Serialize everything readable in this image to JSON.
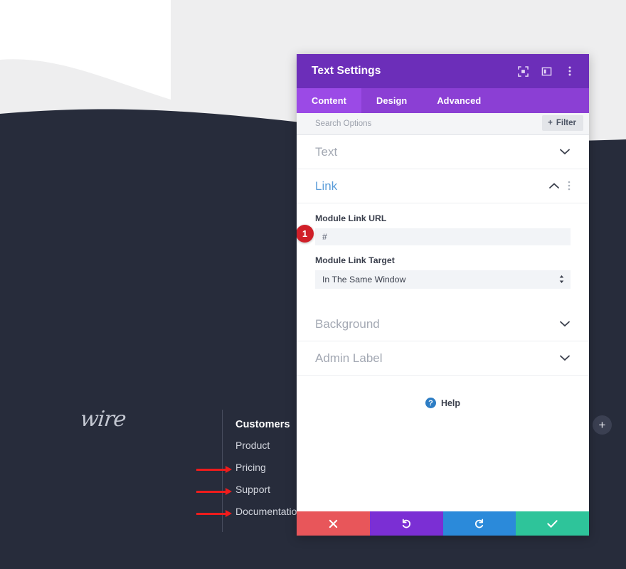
{
  "modal": {
    "title": "Text Settings",
    "header_icons": [
      {
        "name": "fullscreen-icon",
        "glyph": "⬚"
      },
      {
        "name": "layout-panel-icon",
        "glyph": "▧"
      },
      {
        "name": "kebab-menu-icon",
        "glyph": "⋮"
      }
    ],
    "tabs": [
      {
        "label": "Content",
        "active": true
      },
      {
        "label": "Design",
        "active": false
      },
      {
        "label": "Advanced",
        "active": false
      }
    ],
    "search": {
      "placeholder": "Search Options",
      "filter_label": "Filter",
      "filter_plus": "+"
    },
    "sections": [
      {
        "label": "Text",
        "open": false,
        "chevron": "∨"
      },
      {
        "label": "Link",
        "open": true,
        "chevron": "∧",
        "kebab": "⋮"
      },
      {
        "label": "Background",
        "open": false,
        "chevron": "∨"
      },
      {
        "label": "Admin Label",
        "open": false,
        "chevron": "∨"
      }
    ],
    "link_fields": {
      "url_label": "Module Link URL",
      "url_value": "#",
      "url_badge": "1",
      "target_label": "Module Link Target",
      "target_value": "In The Same Window",
      "select_arrows": "⬍"
    },
    "help": {
      "icon_glyph": "?",
      "label": "Help"
    },
    "footer_buttons": [
      {
        "name": "cancel-button",
        "glyph": "✖",
        "color": "#e8565a"
      },
      {
        "name": "undo-button",
        "glyph": "↺",
        "color": "#7b2fd4"
      },
      {
        "name": "redo-button",
        "glyph": "↻",
        "color": "#2b8ada"
      },
      {
        "name": "save-button",
        "glyph": "✔",
        "color": "#2ec49a"
      }
    ]
  },
  "page": {
    "logo_text": "wire",
    "footer_heading": "Customers",
    "footer_links": [
      {
        "label": "Product",
        "arrow": false
      },
      {
        "label": "Pricing",
        "arrow": true
      },
      {
        "label": "Support",
        "arrow": true
      },
      {
        "label": "Documentation",
        "arrow": true
      }
    ],
    "add_button_glyph": "+",
    "colors": {
      "dark": "#272c3b",
      "light": "#eeeeef",
      "white": "#ffffff",
      "accent_purple": "#6c2eb9",
      "annotation_red": "#ee1c1c"
    }
  }
}
